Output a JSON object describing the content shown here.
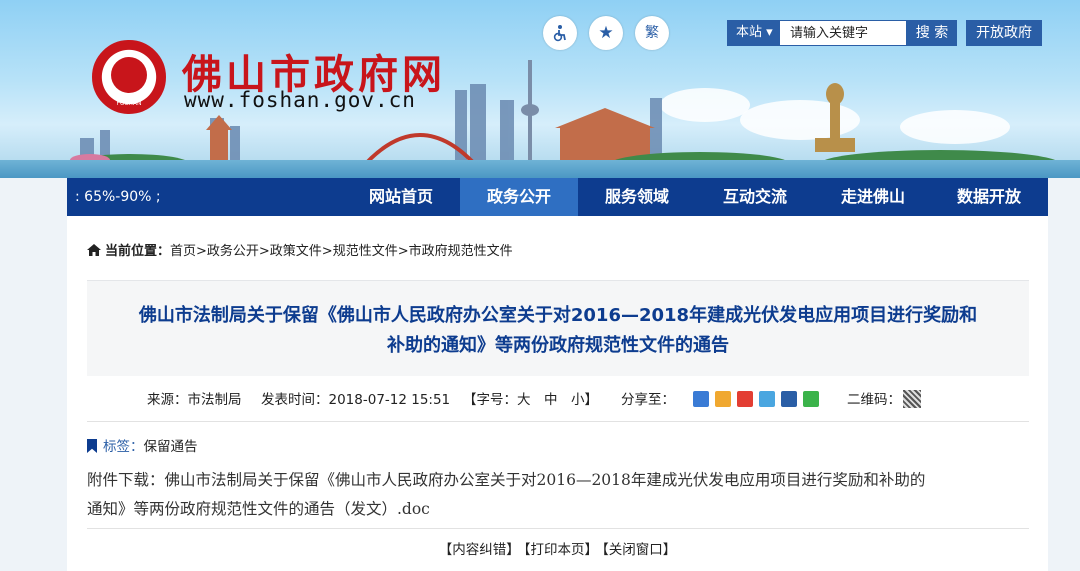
{
  "header": {
    "site_name": "佛山市政府网",
    "site_url": "www.foshan.gov.cn",
    "logo_text": "FOSHAN",
    "accessibility_icon": "wheelchair-icon",
    "favorite_icon": "star-icon",
    "traditional_label": "繁",
    "search": {
      "scope_label": "本站 ▾",
      "placeholder": "请输入关键字",
      "button_label": "搜 索"
    },
    "open_gov_label": "开放政府"
  },
  "nav": {
    "left_text": ": 65%-90% ;",
    "items": [
      {
        "label": "网站首页"
      },
      {
        "label": "政务公开",
        "active": true
      },
      {
        "label": "服务领域"
      },
      {
        "label": "互动交流"
      },
      {
        "label": "走进佛山"
      },
      {
        "label": "数据开放"
      }
    ]
  },
  "breadcrumb": {
    "label": "当前位置：",
    "path": "首页>政务公开>政策文件>规范性文件>市政府规范性文件"
  },
  "article": {
    "title_line1": "佛山市法制局关于保留《佛山市人民政府办公室关于对2016—2018年建成光伏发电应用项目进行奖励和",
    "title_line2": "补助的通知》等两份政府规范性文件的通告",
    "source": "来源：市法制局",
    "publish_time": "发表时间：2018-07-12 15:51",
    "font_size_label": "【字号：大　中　小】",
    "share_label": "分享至：",
    "qr_label": "二维码：",
    "tags_label": "标签：",
    "tags_value": "保留通告",
    "attachment_line1": "附件下载：佛山市法制局关于保留《佛山市人民政府办公室关于对2016—2018年建成光伏发电应用项目进行奖励和补助的",
    "attachment_line2": "通知》等两份政府规范性文件的通告（发文）.doc",
    "actions": [
      "【内容纠错】",
      "【打印本页】",
      "【关闭窗口】"
    ]
  },
  "colors": {
    "brand_red": "#c8151b",
    "nav_blue": "#0d3c8f",
    "nav_active": "#2f6fc2",
    "button_blue": "#2a5ea6"
  }
}
